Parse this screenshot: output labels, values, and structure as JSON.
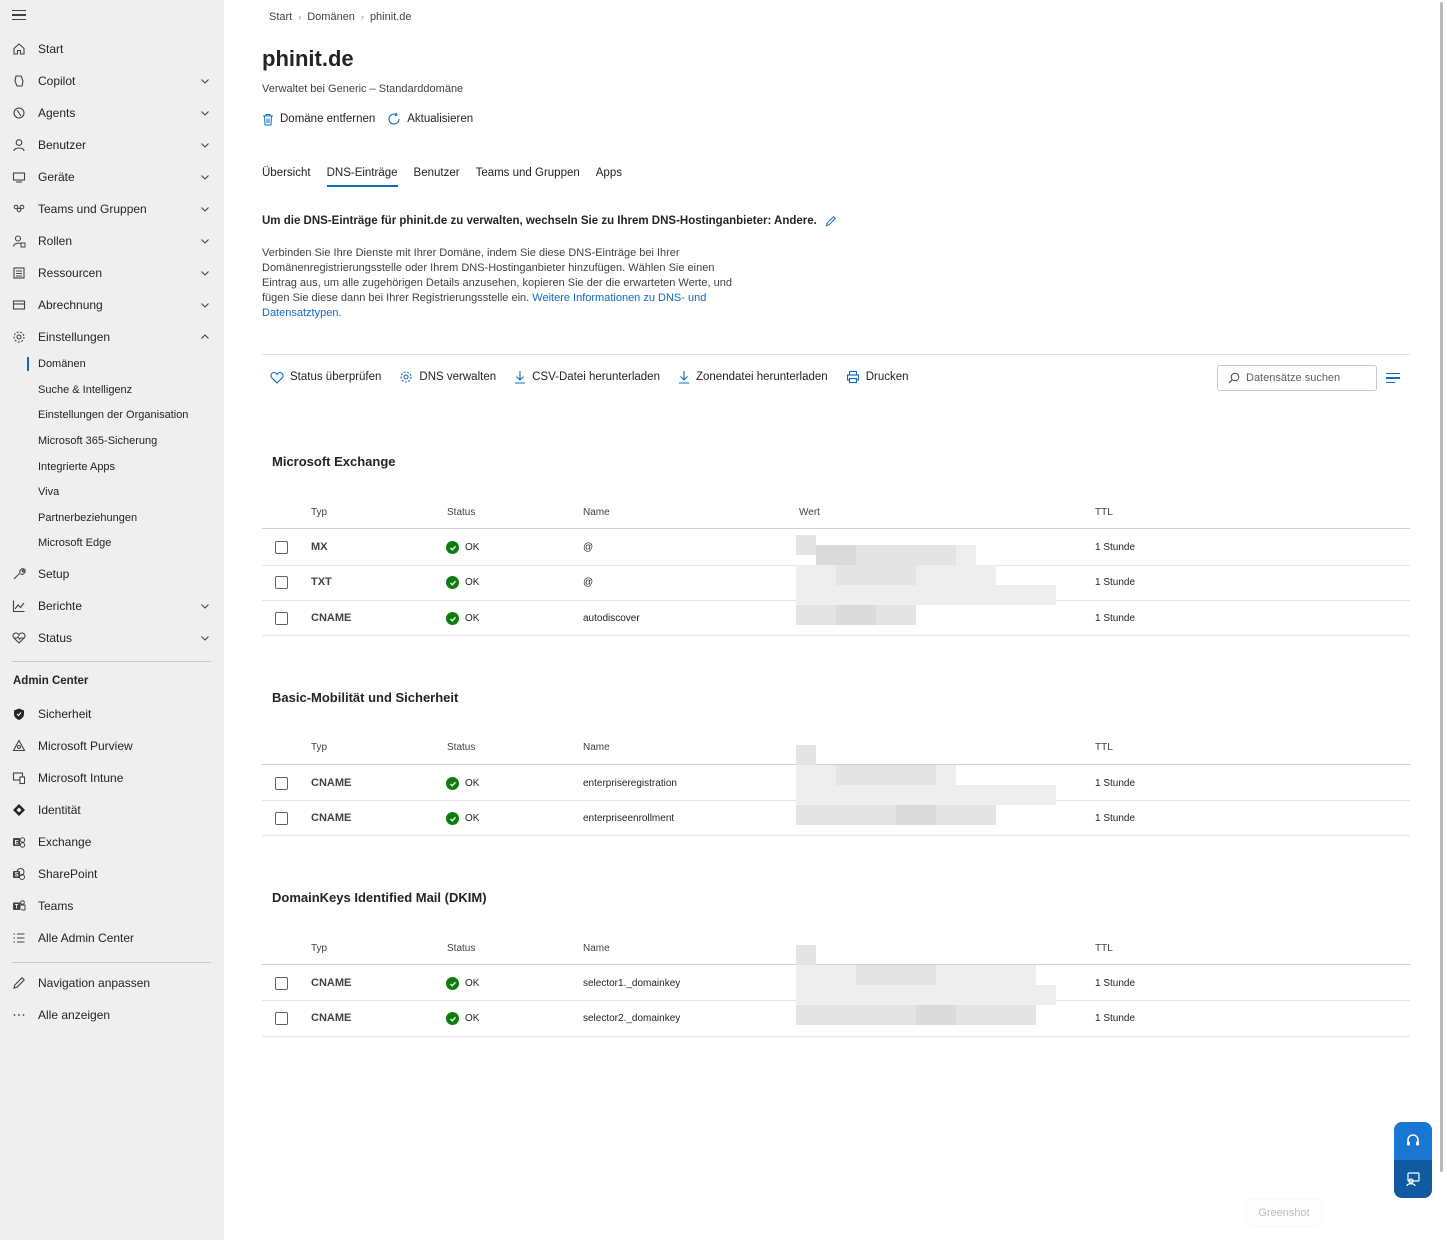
{
  "sidebar": {
    "items": [
      {
        "label": "Start",
        "icon": "home-icon",
        "chevron": false
      },
      {
        "label": "Copilot",
        "icon": "copilot-icon",
        "chevron": true
      },
      {
        "label": "Agents",
        "icon": "agents-icon",
        "chevron": true
      },
      {
        "label": "Benutzer",
        "icon": "person-icon",
        "chevron": true
      },
      {
        "label": "Geräte",
        "icon": "devices-icon",
        "chevron": true
      },
      {
        "label": "Teams und Gruppen",
        "icon": "people-team-icon",
        "chevron": true
      },
      {
        "label": "Rollen",
        "icon": "roles-icon",
        "chevron": true
      },
      {
        "label": "Ressourcen",
        "icon": "resources-icon",
        "chevron": true
      },
      {
        "label": "Abrechnung",
        "icon": "billing-icon",
        "chevron": true
      },
      {
        "label": "Einstellungen",
        "icon": "gear-icon",
        "chevron": true
      }
    ],
    "settings_sub": [
      "Domänen",
      "Suche & Intelligenz",
      "Einstellungen der Organisation",
      "Microsoft 365-Sicherung",
      "Integrierte Apps",
      "Viva",
      "Partnerbeziehungen",
      "Microsoft Edge"
    ],
    "items2": [
      {
        "label": "Setup",
        "icon": "wrench-icon",
        "chevron": false
      },
      {
        "label": "Berichte",
        "icon": "chart-icon",
        "chevron": true
      },
      {
        "label": "Status",
        "icon": "heart-pulse-icon",
        "chevron": true
      }
    ],
    "admin_center_heading": "Admin Center",
    "admin_centers": [
      {
        "label": "Sicherheit",
        "icon": "shield-icon"
      },
      {
        "label": "Microsoft Purview",
        "icon": "purview-icon"
      },
      {
        "label": "Microsoft Intune",
        "icon": "intune-icon"
      },
      {
        "label": "Identität",
        "icon": "identity-icon"
      },
      {
        "label": "Exchange",
        "icon": "exchange-icon"
      },
      {
        "label": "SharePoint",
        "icon": "sharepoint-icon"
      },
      {
        "label": "Teams",
        "icon": "teams-icon"
      },
      {
        "label": "Alle Admin Center",
        "icon": "list-icon"
      }
    ],
    "footer": [
      {
        "label": "Navigation anpassen",
        "icon": "pencil-icon"
      },
      {
        "label": "Alle anzeigen",
        "icon": "more-icon"
      }
    ]
  },
  "breadcrumb": [
    "Start",
    "Domänen",
    "phinit.de"
  ],
  "page": {
    "title": "phinit.de",
    "subtitle": "Verwaltet bei Generic – Standarddomäne",
    "remove_label": "Domäne entfernen",
    "refresh_label": "Aktualisieren"
  },
  "tabs": [
    "Übersicht",
    "DNS-Einträge",
    "Benutzer",
    "Teams und Gruppen",
    "Apps"
  ],
  "active_tab": "DNS-Einträge",
  "notice": "Um die DNS-Einträge für phinit.de zu verwalten, wechseln Sie zu Ihrem DNS-Hostinganbieter: Andere.",
  "description": "Verbinden Sie Ihre Dienste mit Ihrer Domäne, indem Sie diese DNS-Einträge bei Ihrer Domänenregistrierungsstelle oder Ihrem DNS-Hostinganbieter hinzufügen. Wählen Sie einen Eintrag aus, um alle zugehörigen Details anzusehen, kopieren Sie der die erwarteten Werte, und fügen Sie diese dann bei Ihrer Registrierungsstelle ein.",
  "description_link": "Weitere Informationen zu DNS- und Datensatztypen.",
  "toolbar": {
    "check_status": "Status überprüfen",
    "manage_dns": "DNS verwalten",
    "csv_download": "CSV-Datei herunterladen",
    "zone_download": "Zonendatei herunterladen",
    "print": "Drucken",
    "search_placeholder": "Datensätze suchen"
  },
  "columns": {
    "type": "Typ",
    "status": "Status",
    "name": "Name",
    "value": "Wert",
    "ttl": "TTL"
  },
  "groups": [
    {
      "title": "Microsoft Exchange",
      "rows": [
        {
          "type": "MX",
          "status": "OK",
          "name": "@",
          "ttl": "1 Stunde"
        },
        {
          "type": "TXT",
          "status": "OK",
          "name": "@",
          "ttl": "1 Stunde"
        },
        {
          "type": "CNAME",
          "status": "OK",
          "name": "autodiscover",
          "ttl": "1 Stunde"
        }
      ]
    },
    {
      "title": "Basic-Mobilität und Sicherheit",
      "rows": [
        {
          "type": "CNAME",
          "status": "OK",
          "name": "enterpriseregistration",
          "ttl": "1 Stunde"
        },
        {
          "type": "CNAME",
          "status": "OK",
          "name": "enterpriseenrollment",
          "ttl": "1 Stunde"
        }
      ]
    },
    {
      "title": "DomainKeys Identified Mail (DKIM)",
      "rows": [
        {
          "type": "CNAME",
          "status": "OK",
          "name": "selector1._domainkey",
          "ttl": "1 Stunde"
        },
        {
          "type": "CNAME",
          "status": "OK",
          "name": "selector2._domainkey",
          "ttl": "1 Stunde"
        }
      ]
    }
  ],
  "watermark": "Greenshot",
  "colors": {
    "accent": "#0f6cbd",
    "ok": "#107c10",
    "sidebar_bg": "#efefef"
  }
}
